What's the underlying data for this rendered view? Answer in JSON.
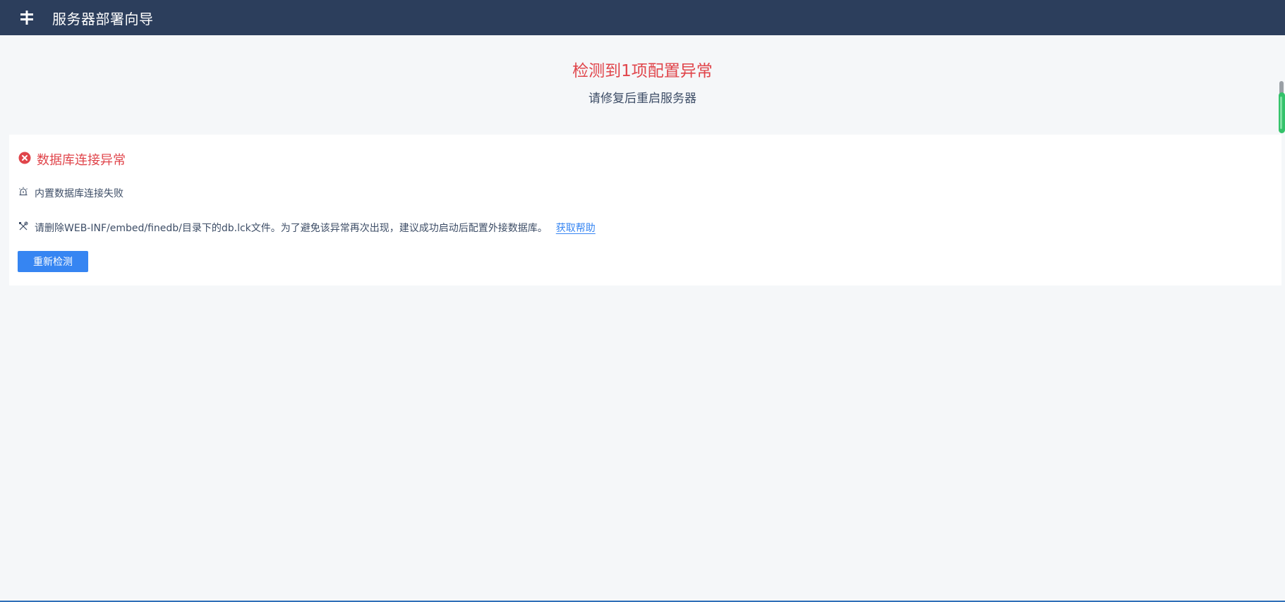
{
  "header": {
    "title": "服务器部署向导",
    "logo_icon": "fork-logo-icon"
  },
  "summary": {
    "title": "检测到1项配置异常",
    "subtitle": "请修复后重启服务器"
  },
  "error": {
    "icon": "error-circle-icon",
    "title": "数据库连接异常",
    "reason_icon": "alarm-icon",
    "reason": "内置数据库连接失败",
    "fix_icon": "tools-icon",
    "fix": "请删除WEB-INF/embed/finedb/目录下的db.lck文件。为了避免该异常再次出现，建议成功启动后配置外接数据库。",
    "help_link": "获取帮助"
  },
  "actions": {
    "recheck_label": "重新检测"
  },
  "colors": {
    "header_bg": "#2c3e5c",
    "error": "#e0454b",
    "primary": "#3685f2",
    "page_bg": "#f5f7f9"
  }
}
